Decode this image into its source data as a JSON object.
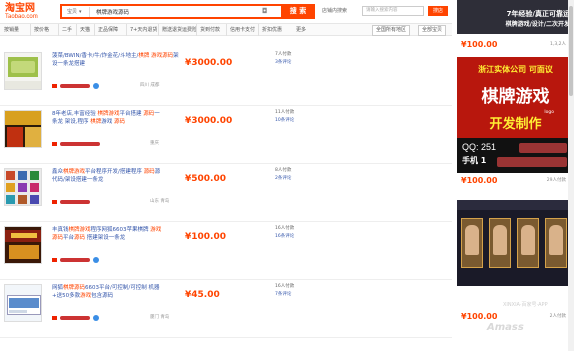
{
  "header": {
    "logo_cn": "淘宝网",
    "logo_en": "Taobao.com",
    "search_scope": "宝贝",
    "search_query": "棋牌游戏源码",
    "search_button": "搜 索",
    "shop_search_label": "店铺内搜索",
    "shop_search_placeholder": "请输入搜索内容",
    "shop_search_button": "搜店"
  },
  "filters": [
    "按销量",
    "按价格",
    "二手",
    "天猫",
    "正品保障",
    "7+天内退货",
    "赠送退货运费险",
    "货到付款",
    "信用卡支付",
    "折扣优惠",
    "更多",
    "全国所有地区",
    "全部宝贝"
  ],
  "items": [
    {
      "title_parts": [
        "菠菜/BWIN/香卡/牛/炸金花/斗地主/",
        "棋牌",
        " ",
        "游戏源码",
        "架设一条龙搭建"
      ],
      "price": "¥3000.00",
      "paid": "7人付款",
      "reviews": "3条评论",
      "location": "四川 成都"
    },
    {
      "title_parts": [
        "8年老店,丰富经验 ",
        "棋牌游戏",
        "平台搭建 ",
        "源码",
        "一条龙 架设,程序 ",
        "棋牌",
        "游戏 ",
        "源码"
      ],
      "price": "¥3000.00",
      "paid": "11人付款",
      "reviews": "10条评论",
      "location": "重庆"
    },
    {
      "title_parts": [
        "鑫众",
        "棋牌游戏",
        "平台程序开发/搭建程序 ",
        "源码",
        "源代码/架设搭建一条龙"
      ],
      "price": "¥500.00",
      "paid": "8人付款",
      "reviews": "2条评论",
      "location": "山东 青岛"
    },
    {
      "title_parts": [
        "丰真钱",
        "棋牌游戏",
        "程序网狐6603苹果棋牌 ",
        "游戏源码",
        "平台",
        "源码",
        " 搭建架设一条龙"
      ],
      "price": "¥100.00",
      "paid": "16人付款",
      "reviews": "16条评论",
      "location": ""
    },
    {
      "title_parts": [
        "网狐",
        "棋牌源码",
        "6603平台/可控制/可控制 机器+送50多款",
        "游戏",
        "包含源码"
      ],
      "price": "¥45.00",
      "paid": "16人付款",
      "reviews": "7条评论",
      "location": "厦门 青岛"
    }
  ],
  "ads": {
    "ad1_line1": "7年经验/真正可靠运",
    "ad1_line2": "棋牌游戏/设计/二次开发",
    "ad1_price": "¥100.00",
    "ad1_paid": "1,3,2人",
    "ad2_line1": "浙江实体公司 可面议",
    "ad2_line2": "棋牌游戏",
    "ad2_logo": "logo",
    "ad2_line3": "开发制作",
    "ad2_qq": "QQ: 251",
    "ad2_phone": "手机 1",
    "ad2_price": "¥100.00",
    "ad2_paid": "29人付款",
    "ad3_price": "¥100.00",
    "ad3_paid": "2人付款"
  },
  "watermark": {
    "line1": "XINXIA·百家号·APP",
    "line2": "Amass"
  }
}
